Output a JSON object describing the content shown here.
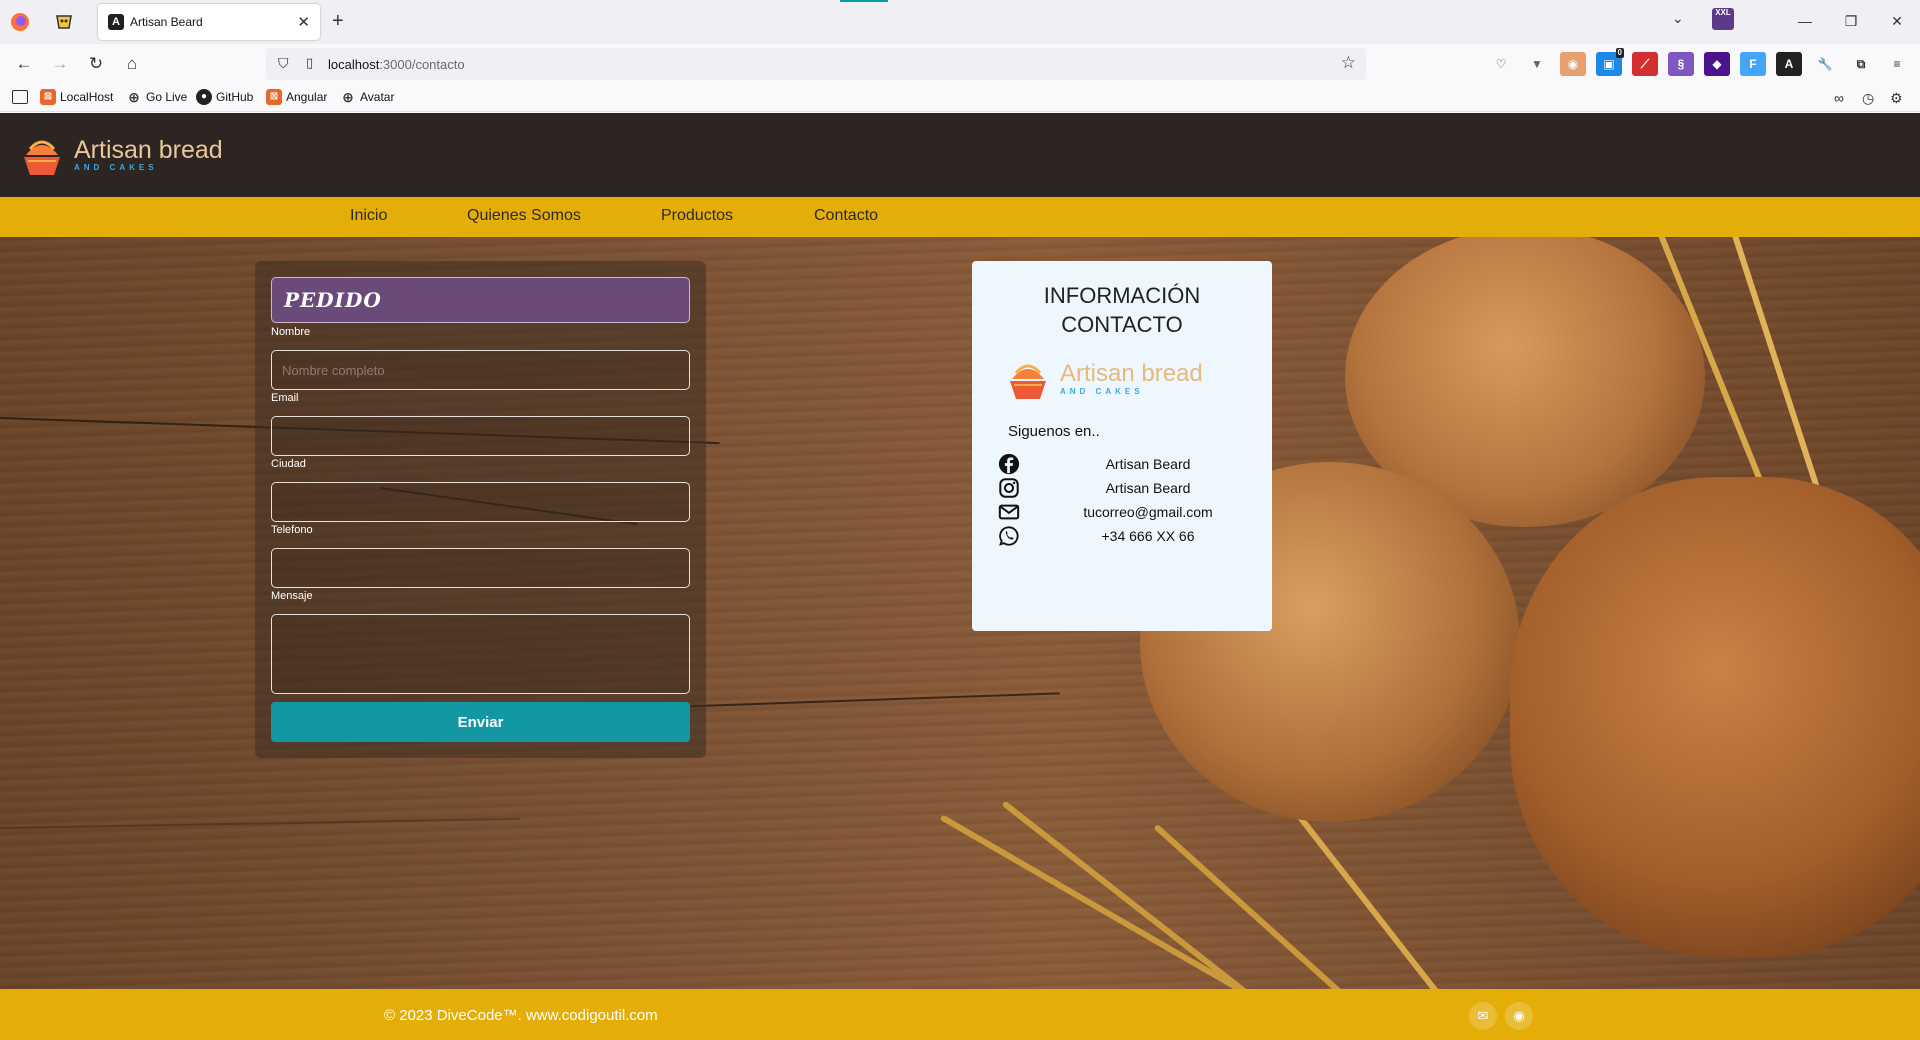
{
  "browser": {
    "tab_title": "Artisan Beard",
    "url_host": "localhost",
    "url_path": ":3000/contacto",
    "bookmarks": [
      "LocalHost",
      "Go Live",
      "GitHub",
      "Angular",
      "Avatar"
    ],
    "ext_badge": "0",
    "xxl_badge": "XXL"
  },
  "header": {
    "brand_name": "Artisan bread",
    "brand_sub": "AND CAKES"
  },
  "menu": [
    "Inicio",
    "Quienes Somos",
    "Productos",
    "Contacto"
  ],
  "form": {
    "title": "PEDIDO",
    "fields": [
      {
        "label": "Nombre",
        "placeholder": "Nombre completo",
        "value": ""
      },
      {
        "label": "Email",
        "placeholder": "",
        "value": ""
      },
      {
        "label": "Ciudad",
        "placeholder": "",
        "value": ""
      },
      {
        "label": "Telefono",
        "placeholder": "",
        "value": ""
      }
    ],
    "message_label": "Mensaje",
    "submit_label": "Enviar"
  },
  "info": {
    "title_line1": "INFORMACIÓN",
    "title_line2": "CONTACTO",
    "brand_name": "Artisan bread",
    "brand_sub": "AND CAKES",
    "follow_label": "Siguenos en..",
    "contacts": [
      {
        "icon": "facebook-icon",
        "text": "Artisan Beard"
      },
      {
        "icon": "instagram-icon",
        "text": "Artisan Beard"
      },
      {
        "icon": "envelope-icon",
        "text": "tucorreo@gmail.com"
      },
      {
        "icon": "whatsapp-icon",
        "text": "+34 666 XX 66"
      }
    ]
  },
  "footer": {
    "copyright": "© 2023 DiveCode™. www.codigoutil.com"
  },
  "colors": {
    "header_bg": "#2d2522",
    "menu_bg": "#e5ad07",
    "submit_bg": "#1297a3",
    "form_title_bg": "#6a4a78",
    "info_card_bg": "#eef7fd"
  }
}
